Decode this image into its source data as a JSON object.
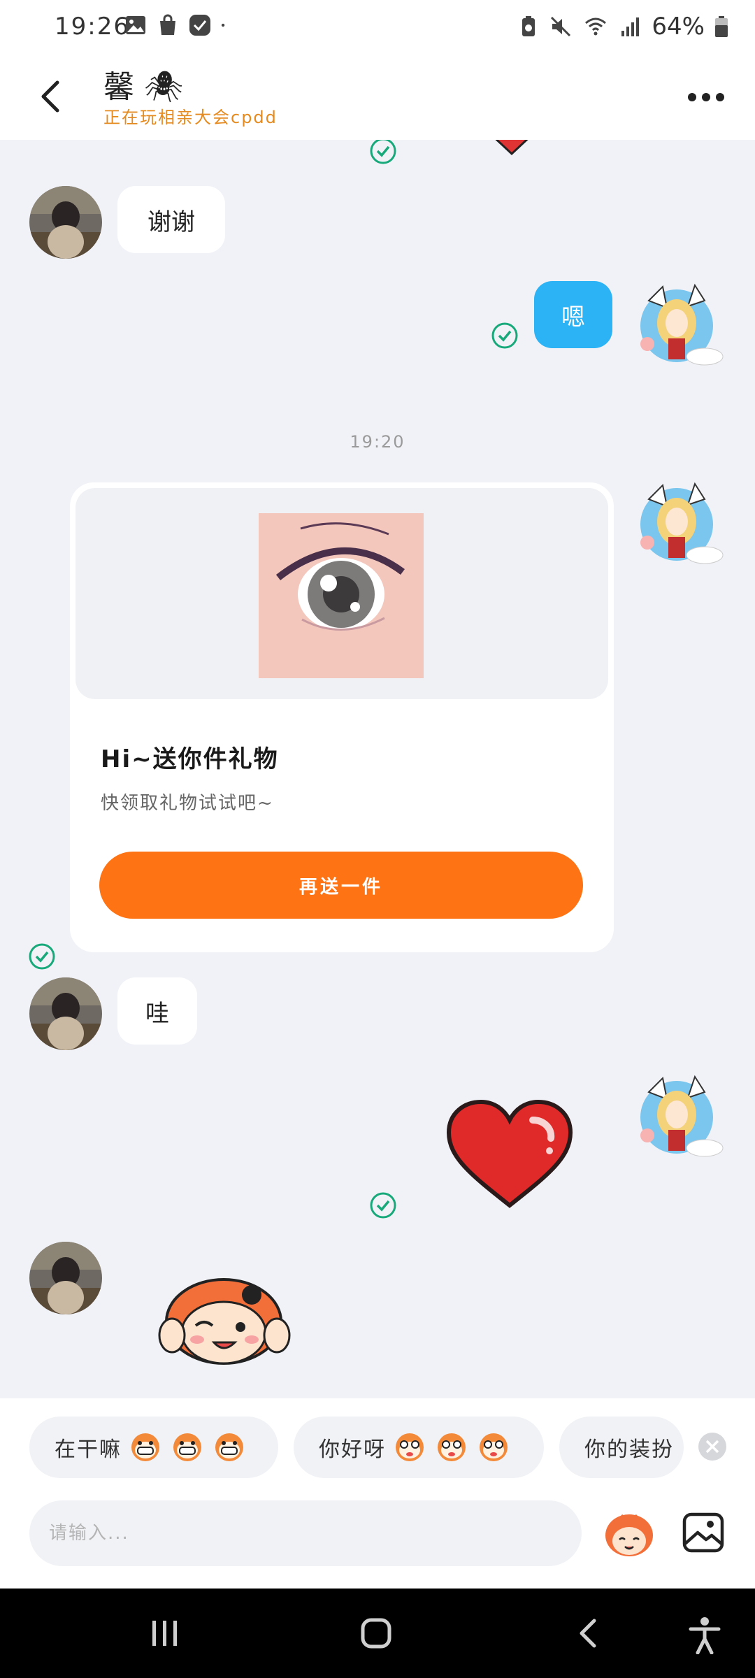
{
  "status_bar": {
    "time": "19:26",
    "battery": "64%",
    "left_icons": [
      "image-notification-icon",
      "shopping-bag-icon",
      "app-notification-icon",
      "dot-icon"
    ],
    "right_icons": [
      "battery-saver-icon",
      "mute-icon",
      "wifi-icon",
      "signal-icon",
      "battery-icon"
    ]
  },
  "header": {
    "contact_name": "馨 🕷",
    "contact_status": "正在玩相亲大会cpdd",
    "back_icon": "chevron-left-icon",
    "more_icon": "more-dots-icon"
  },
  "messages": {
    "m1_text": "谢谢",
    "m2_text": "嗯",
    "timestamp": "19:20",
    "gift_title": "Hi~送你件礼物",
    "gift_subtitle": "快领取礼物试试吧~",
    "gift_button": "再送一件",
    "m4_text": "哇",
    "m5_sticker": "heart-sticker",
    "m6_sticker": "cartoon-sticker"
  },
  "quick_replies": [
    {
      "label": "在干嘛",
      "faces": 3
    },
    {
      "label": "你好呀",
      "faces": 3
    },
    {
      "label": "你的装扮",
      "faces": 0
    }
  ],
  "input": {
    "placeholder": "请输入..."
  },
  "colors": {
    "accent_orange": "#fe7415",
    "bubble_blue": "#2bb3f5",
    "status_orange": "#e58a1e",
    "check_green": "#18a97a",
    "chat_bg": "#f1f2f7"
  }
}
